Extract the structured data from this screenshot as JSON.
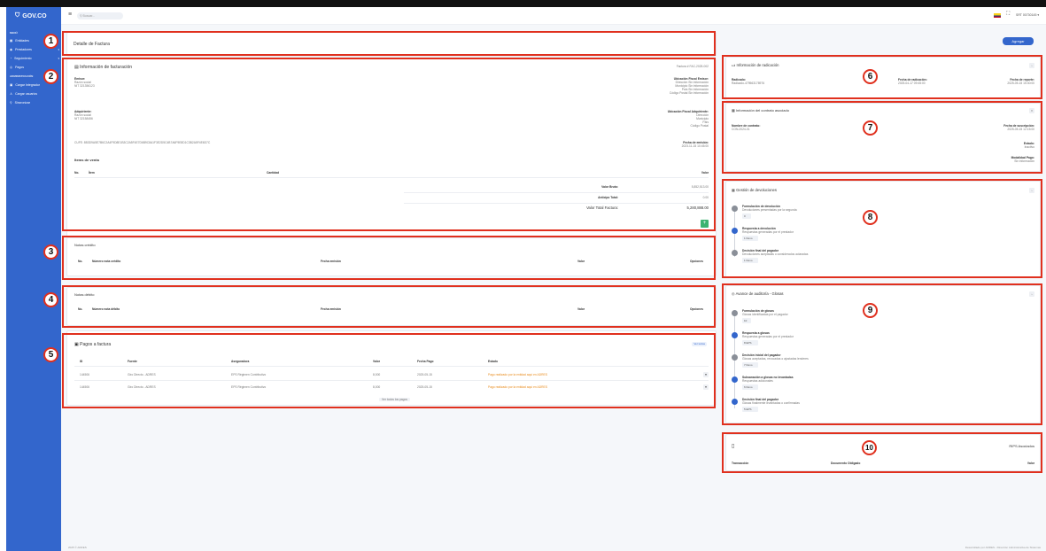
{
  "app": {
    "logo": "GOV.CO"
  },
  "sidebar": {
    "section1": "MENÚ",
    "items1": [
      {
        "label": "Entidades",
        "icon": "building-icon"
      },
      {
        "label": "Prestadores",
        "icon": "people-icon"
      },
      {
        "label": "Seguimiento",
        "icon": "chart-icon"
      },
      {
        "label": "Pagos",
        "icon": "money-icon"
      }
    ],
    "section2": "ADMINISTRACIÓN",
    "items2": [
      {
        "label": "Cargar Integrador",
        "icon": "upload-icon"
      },
      {
        "label": "Cargar usuarios",
        "icon": "user-icon"
      },
      {
        "label": "Sincronizar",
        "icon": "pin-icon"
      }
    ]
  },
  "topbar": {
    "search_placeholder": "Buscar...",
    "user": "SRT 00730145"
  },
  "page": {
    "title": "Detalle de Factura",
    "add_button": "Agregar"
  },
  "billing": {
    "title": "Información de facturación",
    "invoice_no": "Factura # FAC-2025-002",
    "emisor_label": "Emisor:",
    "emisor_name": "Razón social",
    "emisor_nit": "NIT 321356123",
    "emisor_loc_label": "Ubicación Fiscal Emisor:",
    "emisor_loc": [
      "Dirección Sin información",
      "Municipio Sin información",
      "País Sin información",
      "Código Postal Sin información"
    ],
    "adq_label": "Adquiriente:",
    "adq_name": "Razón social",
    "adq_nit": "NIT 32158456",
    "adq_loc_label": "Ubicación Fiscal Adquiriente:",
    "adq_loc": [
      "Dirección",
      "Municipio",
      "País",
      "Código Postal"
    ],
    "cufe": "CUFE: 8B3D9A5E7B6C2A4F9D8E1B3C2A5F4E7D6B9C8A1F3E2D5C4B7A6F9E8D1C3B2A5F4E6D7C",
    "date_label": "Fecha de emisión:",
    "date": "2023-11-15 10:45:00",
    "items_title": "Items de venta",
    "cols": [
      "No.",
      "Ítem",
      "Cantidad",
      "Valor"
    ],
    "gross_label": "Valor Bruto:",
    "gross": "5,852,513.00",
    "advance_label": "Anticipo Total:",
    "advance": "0.00",
    "total_label": "Valor Total Factura:",
    "total": "5,280,888.00"
  },
  "credit": {
    "title": "Notas crédito",
    "cols": [
      "No.",
      "Número nota crédito",
      "Fecha emisión",
      "Valor",
      "Opciones"
    ]
  },
  "debit": {
    "title": "Notas débito",
    "cols": [
      "No.",
      "Número nota débito",
      "Fecha emisión",
      "Valor",
      "Opciones"
    ]
  },
  "payments": {
    "title": "Pagos a factura",
    "tag": "Ver todos",
    "cols": [
      "ID",
      "Fuente",
      "Aseguradora",
      "Valor",
      "Fecha Pago",
      "Estado"
    ],
    "rows": [
      {
        "id": "144506",
        "source": "Giro Directo - ADRES",
        "insurer": "EPS Régimen Contributivo",
        "value": "8,000",
        "date": "2025-05-15",
        "status": "Pago realizado por la entidad aquí en ADRES"
      },
      {
        "id": "144506",
        "source": "Giro Directo - ADRES",
        "insurer": "EPS Régimen Contributivo",
        "value": "8,000",
        "date": "2025-05-15",
        "status": "Pago realizado por la entidad aquí en ADRES"
      }
    ],
    "more": "Ver todos los pagos"
  },
  "radicacion": {
    "title": "Información de radicación",
    "c1_label": "Radicado:",
    "c1": "Radicado-479563178976",
    "c2_label": "Fecha de radicación:",
    "c2": "2025-04-17 09:45:00",
    "c3_label": "Fecha de reporte:",
    "c3": "2025-05-15 15:30:00"
  },
  "contrato": {
    "title": "Información del contrato asociado",
    "name_label": "Nombre de contrato:",
    "name": "CON-2024-01",
    "sign_label": "Fecha de suscripción:",
    "sign": "2025-05-15 12:15:00",
    "state_label": "Estado:",
    "state": "Inactivo",
    "mod_label": "Modalidad Pago:",
    "mod": "Sin información"
  },
  "devoluciones": {
    "title": "Gestión de devoluciones",
    "steps": [
      {
        "title": "Formulación de devolución",
        "sub": "Devoluciones presentadas por la segunda",
        "pill": "0"
      },
      {
        "title": "Respuesta a devolución",
        "sub": "Respuestas generadas por el prestador",
        "pill": "1   Devo"
      },
      {
        "title": "Decisión final del pagador",
        "sub": "Devoluciones aceptadas o considerados aclaradas",
        "pill": "1   Devo"
      }
    ]
  },
  "auditoria": {
    "title": "Avance de auditoría - Glosas",
    "steps": [
      {
        "title": "Formulación de glosas",
        "sub": "Glosas identificadas por el pagador",
        "pill": "10"
      },
      {
        "title": "Respuesta a glosas",
        "sub": "Respuestas generadas por el prestador",
        "pill": "8   EPS"
      },
      {
        "title": "Decisión inicial del pagador",
        "sub": "Glosas aceptadas, revocadas o ajustadas lenderes",
        "pill": "7   Devo"
      },
      {
        "title": "Subsanación a glosas no levantadas",
        "sub": "Respuestas adicionales",
        "pill": "6   Devo"
      },
      {
        "title": "Decisión final del pagador",
        "sub": "Glosas finalmente levantadas o confirmadas",
        "pill": "5   EPS"
      }
    ]
  },
  "rips": {
    "title": "RIPS Asociados",
    "cols": [
      "Transacción",
      "Documento Obligado",
      "Valor"
    ]
  },
  "footer": {
    "left": "2025 © ADRES",
    "right": "Desarrollado por ADRES - Dirección Administrativa de Sistemas"
  },
  "annotations": [
    "1",
    "2",
    "3",
    "4",
    "5",
    "6",
    "7",
    "8",
    "9",
    "10"
  ],
  "colors": {
    "sidebar": "#3366cc",
    "annotation": "#e0301e",
    "green": "#3cb371"
  }
}
